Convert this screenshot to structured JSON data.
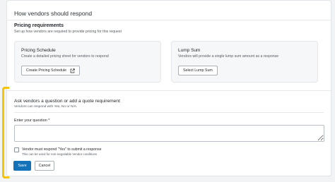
{
  "header": {
    "title": "How vendors should respond"
  },
  "pricing": {
    "title": "Pricing requirements",
    "subtitle": "Set up how vendors are required to provide pricing for this request",
    "options": [
      {
        "title": "Pricing Schedule",
        "description": "Create a detailed pricing sheet for vendors to respond",
        "button_label": "Create Pricing Schedule",
        "button_icon": "external-link-icon"
      },
      {
        "title": "Lump Sum",
        "description": "Vendors will provide a single lump sum amount as a response",
        "button_label": "Select Lump Sum"
      }
    ]
  },
  "question": {
    "title": "Ask vendors a question or add a quote requirement",
    "subtitle": "Vendors can respond with Yes, No or N/A.",
    "field_label": "Enter your question *",
    "field_value": "",
    "checkbox_label": "Vendor must respond \"Yes\" to submit a response",
    "checkbox_hint": "This can be used for non-negotiable Vendor conditions",
    "checkbox_checked": false
  },
  "actions": {
    "save_label": "Save",
    "cancel_label": "Cancel"
  },
  "colors": {
    "primary": "#1472b8",
    "highlight": "#f6c400",
    "panel": "#f6f7f9"
  }
}
